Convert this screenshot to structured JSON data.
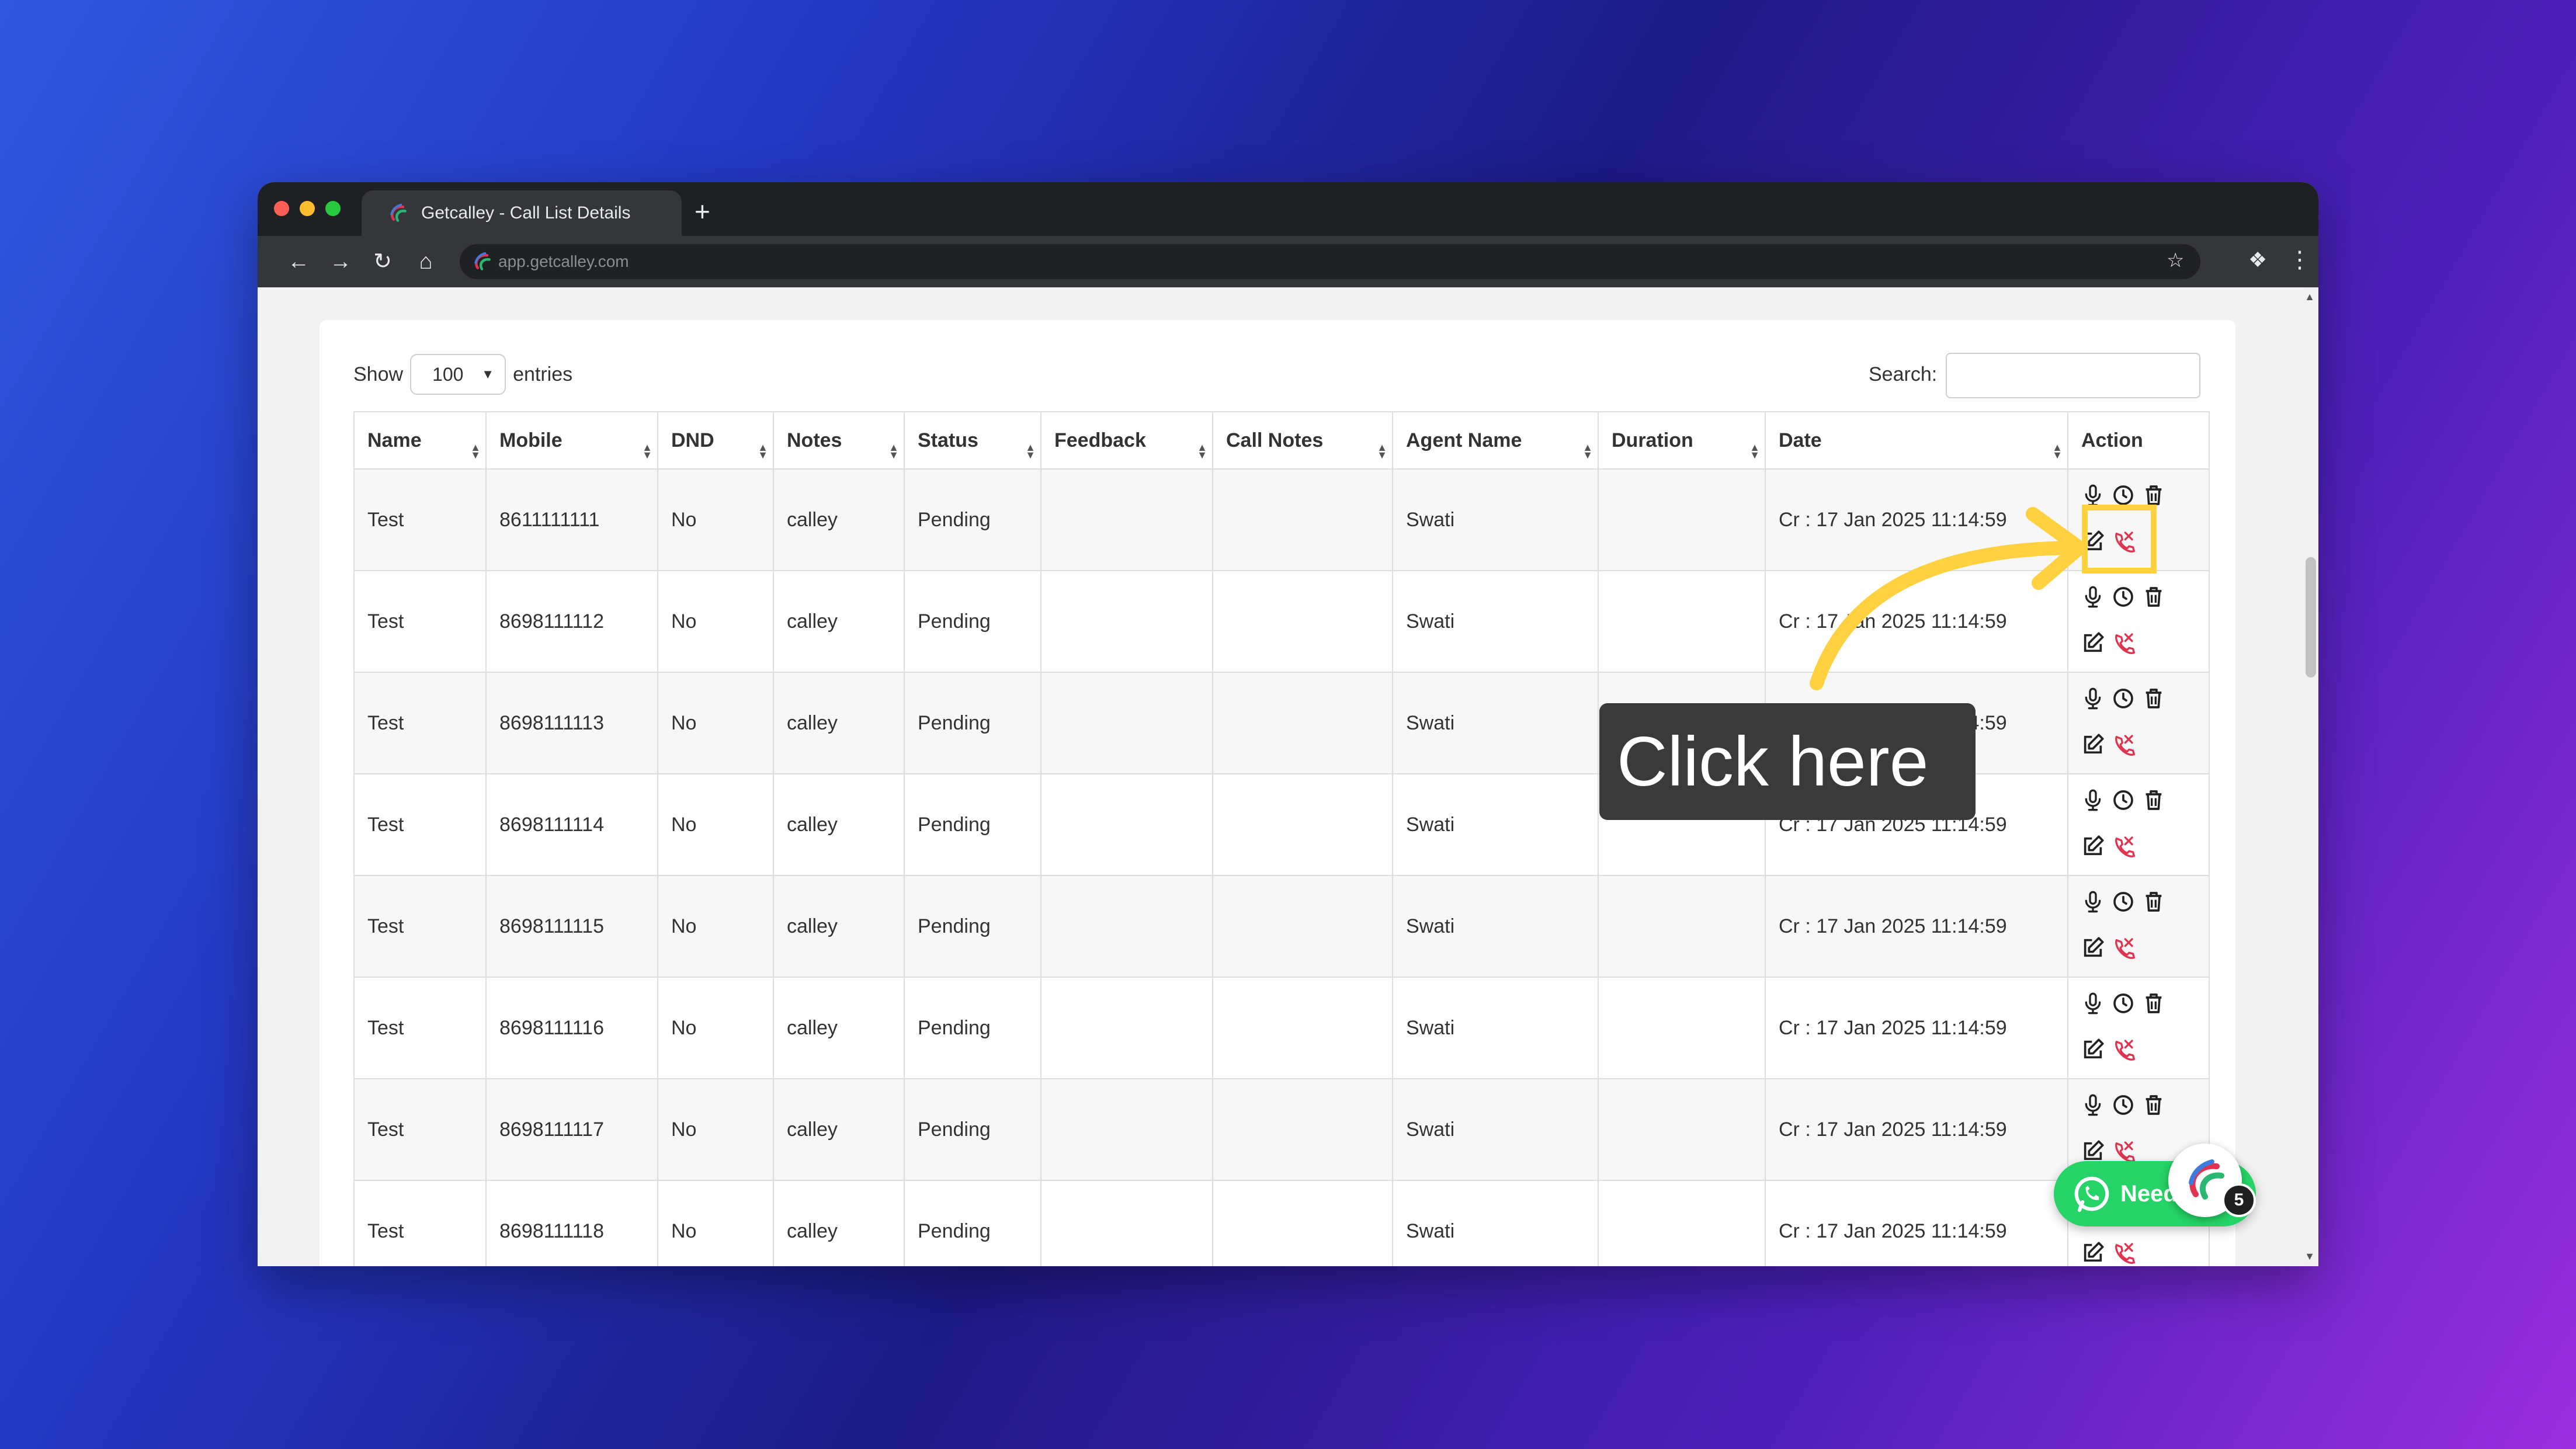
{
  "browser": {
    "tab_title": "Getcalley - Call List Details",
    "new_tab_symbol": "+",
    "url": "app.getcalley.com"
  },
  "controls": {
    "show_label": "Show",
    "entries_value": "100",
    "entries_label": "entries",
    "search_label": "Search:",
    "search_value": ""
  },
  "table": {
    "columns": [
      "Name",
      "Mobile",
      "DND",
      "Notes",
      "Status",
      "Feedback",
      "Call Notes",
      "Agent Name",
      "Duration",
      "Date",
      "Action"
    ],
    "rows": [
      {
        "name": "Test",
        "mobile": "8611111111",
        "dnd": "No",
        "notes": "calley",
        "status": "Pending",
        "feedback": "",
        "call_notes": "",
        "agent": "Swati",
        "duration": "",
        "date": "Cr : 17 Jan 2025 11:14:59"
      },
      {
        "name": "Test",
        "mobile": "8698111112",
        "dnd": "No",
        "notes": "calley",
        "status": "Pending",
        "feedback": "",
        "call_notes": "",
        "agent": "Swati",
        "duration": "",
        "date": "Cr : 17 Jan 2025 11:14:59"
      },
      {
        "name": "Test",
        "mobile": "8698111113",
        "dnd": "No",
        "notes": "calley",
        "status": "Pending",
        "feedback": "",
        "call_notes": "",
        "agent": "Swati",
        "duration": "",
        "date": "Cr : 17 Jan 2025 11:14:59"
      },
      {
        "name": "Test",
        "mobile": "8698111114",
        "dnd": "No",
        "notes": "calley",
        "status": "Pending",
        "feedback": "",
        "call_notes": "",
        "agent": "Swati",
        "duration": "",
        "date": "Cr : 17 Jan 2025 11:14:59"
      },
      {
        "name": "Test",
        "mobile": "8698111115",
        "dnd": "No",
        "notes": "calley",
        "status": "Pending",
        "feedback": "",
        "call_notes": "",
        "agent": "Swati",
        "duration": "",
        "date": "Cr : 17 Jan 2025 11:14:59"
      },
      {
        "name": "Test",
        "mobile": "8698111116",
        "dnd": "No",
        "notes": "calley",
        "status": "Pending",
        "feedback": "",
        "call_notes": "",
        "agent": "Swati",
        "duration": "",
        "date": "Cr : 17 Jan 2025 11:14:59"
      },
      {
        "name": "Test",
        "mobile": "8698111117",
        "dnd": "No",
        "notes": "calley",
        "status": "Pending",
        "feedback": "",
        "call_notes": "",
        "agent": "Swati",
        "duration": "",
        "date": "Cr : 17 Jan 2025 11:14:59"
      },
      {
        "name": "Test",
        "mobile": "8698111118",
        "dnd": "No",
        "notes": "calley",
        "status": "Pending",
        "feedback": "",
        "call_notes": "",
        "agent": "Swati",
        "duration": "",
        "date": "Cr : 17 Jan 2025 11:14:59"
      }
    ],
    "action_icons": [
      "microphone-icon",
      "clock-icon",
      "trash-icon",
      "edit-icon",
      "call-disconnect-icon"
    ]
  },
  "annotation": {
    "tooltip_text": "Click here",
    "highlight_color": "#ffd141"
  },
  "widgets": {
    "whatsapp_label": "Need",
    "notification_count": "5"
  },
  "colors": {
    "whatsapp_green": "#25d366",
    "call_icon_red": "#e0334f"
  }
}
